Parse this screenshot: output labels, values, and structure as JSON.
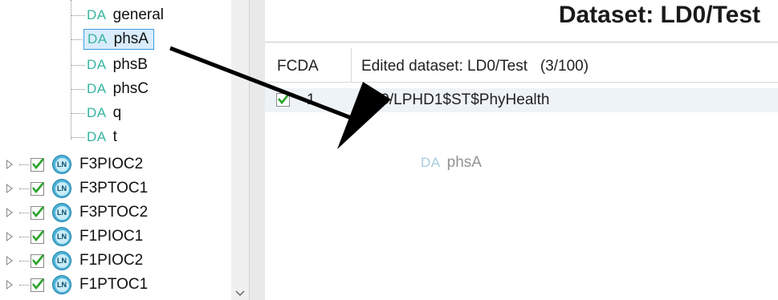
{
  "tree": {
    "da_items": [
      {
        "tag": "DA",
        "label": "general"
      },
      {
        "tag": "DA",
        "label": "phsA"
      },
      {
        "tag": "DA",
        "label": "phsB"
      },
      {
        "tag": "DA",
        "label": "phsC"
      },
      {
        "tag": "DA",
        "label": "q"
      },
      {
        "tag": "DA",
        "label": "t"
      }
    ],
    "ln_badge": "LN",
    "ln_items": [
      {
        "label": "F3PIOC2"
      },
      {
        "label": "F3PTOC1"
      },
      {
        "label": "F3PTOC2"
      },
      {
        "label": "F1PIOC1"
      },
      {
        "label": "F1PIOC2"
      },
      {
        "label": "F1PTOC1"
      }
    ]
  },
  "dataset": {
    "title": "Dataset: LD0/Test",
    "col_fcda": "FCDA",
    "col_dataset": "Edited dataset: LD0/Test   (3/100)",
    "rows": [
      {
        "num": "1",
        "value": "LD0/LPHD1$ST$PhyHealth"
      }
    ]
  },
  "drag_ghost": {
    "tag": "DA",
    "label": "phsA"
  },
  "colors": {
    "da_tag": "#35b5a0",
    "checkmark": "#2aa32a",
    "selection": "#3d9be0",
    "ln_icon": "#4fb3d8"
  }
}
